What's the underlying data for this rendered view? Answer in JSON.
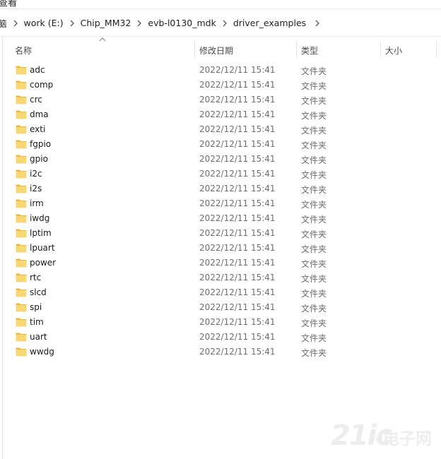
{
  "window": {
    "top_partial_title": "查看"
  },
  "breadcrumb": {
    "items": [
      {
        "label": "脑"
      },
      {
        "label": "work (E:)"
      },
      {
        "label": "Chip_MM32"
      },
      {
        "label": "evb-l0130_mdk"
      },
      {
        "label": "driver_examples"
      }
    ]
  },
  "columns": {
    "name": "名称",
    "date": "修改日期",
    "type": "类型",
    "size": "大小"
  },
  "sort": {
    "column": "name",
    "direction": "ascending",
    "icon": "sort-up-arrow-icon"
  },
  "files": [
    {
      "name": "adc",
      "date": "2022/12/11 15:41",
      "type": "文件夹"
    },
    {
      "name": "comp",
      "date": "2022/12/11 15:41",
      "type": "文件夹"
    },
    {
      "name": "crc",
      "date": "2022/12/11 15:41",
      "type": "文件夹"
    },
    {
      "name": "dma",
      "date": "2022/12/11 15:41",
      "type": "文件夹"
    },
    {
      "name": "exti",
      "date": "2022/12/11 15:41",
      "type": "文件夹"
    },
    {
      "name": "fgpio",
      "date": "2022/12/11 15:41",
      "type": "文件夹"
    },
    {
      "name": "gpio",
      "date": "2022/12/11 15:41",
      "type": "文件夹"
    },
    {
      "name": "i2c",
      "date": "2022/12/11 15:41",
      "type": "文件夹"
    },
    {
      "name": "i2s",
      "date": "2022/12/11 15:41",
      "type": "文件夹"
    },
    {
      "name": "irm",
      "date": "2022/12/11 15:41",
      "type": "文件夹"
    },
    {
      "name": "iwdg",
      "date": "2022/12/11 15:41",
      "type": "文件夹"
    },
    {
      "name": "lptim",
      "date": "2022/12/11 15:41",
      "type": "文件夹"
    },
    {
      "name": "lpuart",
      "date": "2022/12/11 15:41",
      "type": "文件夹"
    },
    {
      "name": "power",
      "date": "2022/12/11 15:41",
      "type": "文件夹"
    },
    {
      "name": "rtc",
      "date": "2022/12/11 15:41",
      "type": "文件夹"
    },
    {
      "name": "slcd",
      "date": "2022/12/11 15:41",
      "type": "文件夹"
    },
    {
      "name": "spi",
      "date": "2022/12/11 15:41",
      "type": "文件夹"
    },
    {
      "name": "tim",
      "date": "2022/12/11 15:41",
      "type": "文件夹"
    },
    {
      "name": "uart",
      "date": "2022/12/11 15:41",
      "type": "文件夹"
    },
    {
      "name": "wwdg",
      "date": "2022/12/11 15:41",
      "type": "文件夹"
    }
  ],
  "watermark": {
    "number": "21ic",
    "text": "电子网"
  },
  "colors": {
    "folder_fill": "#f8d775",
    "folder_tab": "#e9b949",
    "secondary_text": "#6d6d6d"
  }
}
